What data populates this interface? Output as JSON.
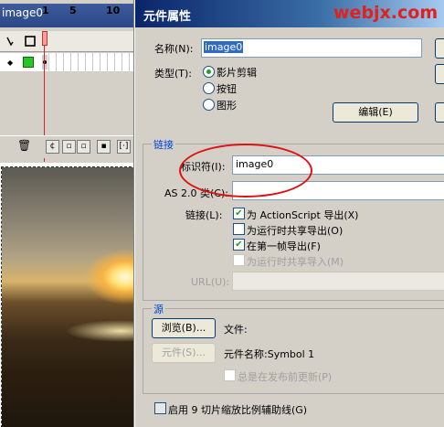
{
  "left_panel": {
    "layer_name": "image0",
    "frame_numbers": [
      "1",
      "5",
      "10"
    ]
  },
  "dialog": {
    "title": "元件属性",
    "watermark": "webjx.com",
    "name_label": "名称(N):",
    "name_value": "image0",
    "type_label": "类型(T):",
    "types": [
      {
        "label": "影片剪辑",
        "selected": true
      },
      {
        "label": "按钮",
        "selected": false
      },
      {
        "label": "图形",
        "selected": false
      }
    ],
    "edit_button": "编辑(E)",
    "linkage": {
      "title": "链接",
      "identifier_label": "标识符(I):",
      "identifier_value": "image0",
      "as2_label": "AS 2.0 类(C):",
      "as2_value": "",
      "linkage_label": "链接(L):",
      "options": [
        {
          "label": "为 ActionScript 导出(X)",
          "checked": true,
          "enabled": true
        },
        {
          "label": "为运行时共享导出(O)",
          "checked": false,
          "enabled": true
        },
        {
          "label": "在第一帧导出(F)",
          "checked": true,
          "enabled": true
        },
        {
          "label": "为运行时共享导入(M)",
          "checked": false,
          "enabled": false
        }
      ],
      "url_label": "URL(U):",
      "url_value": ""
    },
    "source": {
      "title": "源",
      "browse_button": "浏览(B)...",
      "file_label": "文件:",
      "symbol_button": "元件(S)...",
      "symbol_name_label": "元件名称:Symbol 1",
      "always_update_label": "总是在发布前更新(P)"
    },
    "nine_slice_label": "启用 9 切片缩放比例辅助线(G)"
  },
  "colors": {
    "annotation_red": "#e01010",
    "title_blue": "#0a246a",
    "group_title": "#0046d5"
  }
}
